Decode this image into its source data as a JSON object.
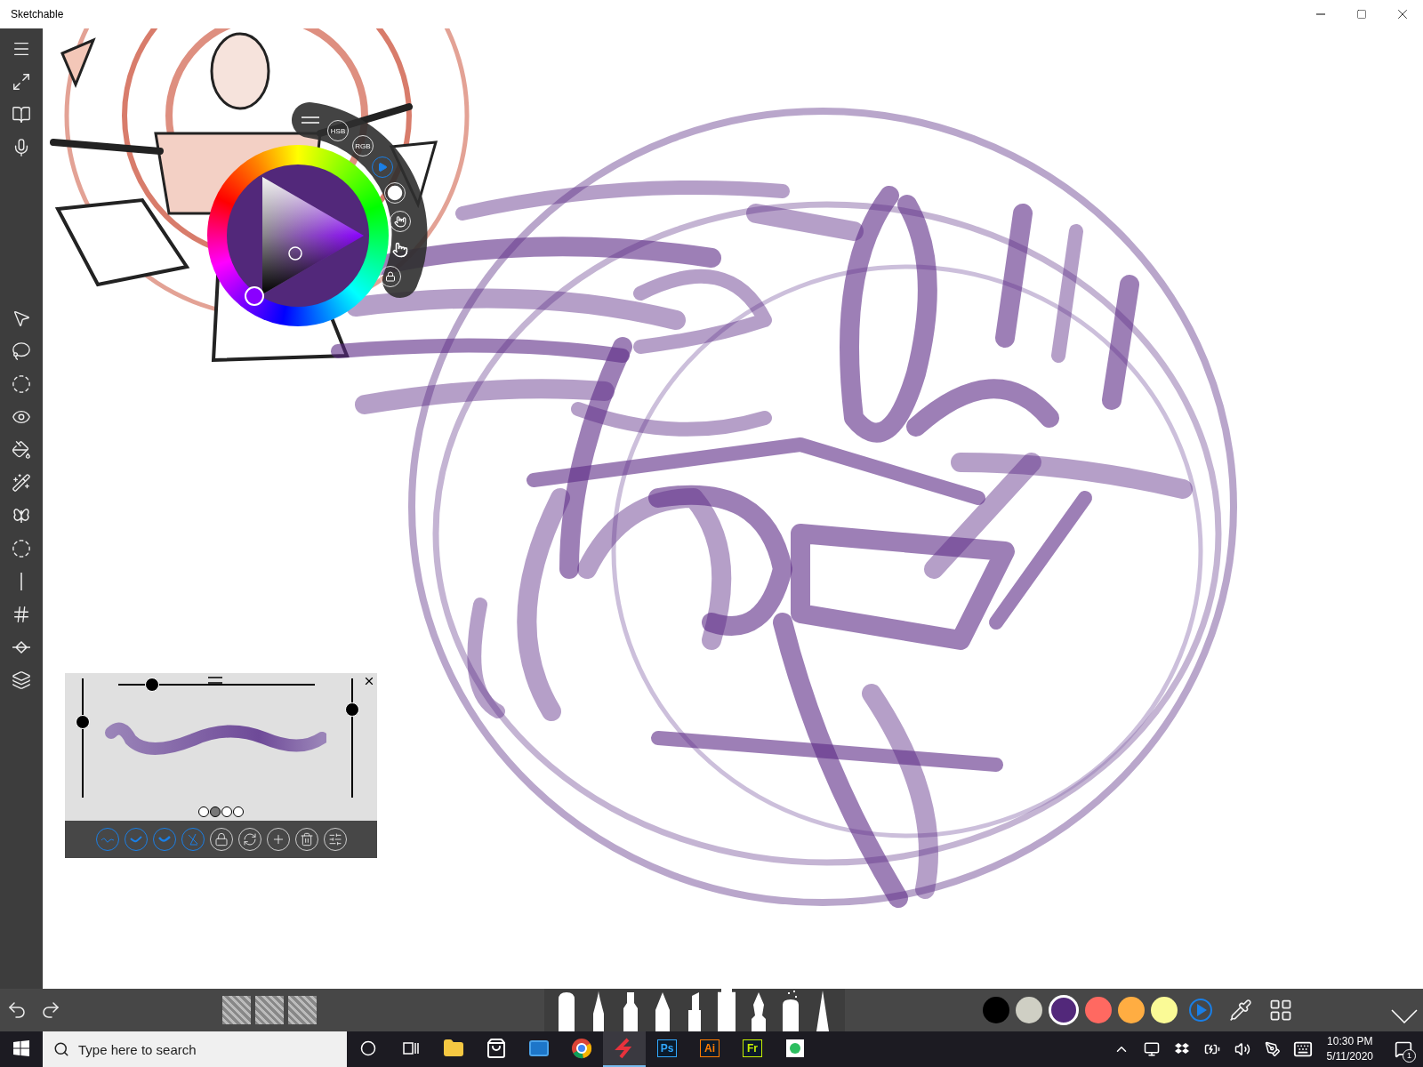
{
  "window": {
    "title": "Sketchable"
  },
  "color_wheel": {
    "modes": [
      {
        "label": "HSB",
        "selected": false
      },
      {
        "label": "RGB",
        "selected": false
      }
    ],
    "play_selected": true
  },
  "brush_panel": {
    "sliders": [
      {
        "kind": "horizontal",
        "level": 0.15
      },
      {
        "kind": "vertical-left",
        "level": 0.65
      },
      {
        "kind": "vertical-right",
        "level": 0.77
      }
    ],
    "pages": [
      {
        "selected": false
      },
      {
        "selected": true
      },
      {
        "selected": false
      },
      {
        "selected": false
      }
    ],
    "actions": [
      {
        "kind": "stroke",
        "active": true
      },
      {
        "kind": "taper-start",
        "active": true
      },
      {
        "kind": "taper-end",
        "active": true
      },
      {
        "kind": "no-pressure",
        "active": true
      },
      {
        "kind": "lock",
        "active": false
      },
      {
        "kind": "sync",
        "active": false
      },
      {
        "kind": "add",
        "active": false
      },
      {
        "kind": "delete",
        "active": false
      },
      {
        "kind": "settings",
        "active": false
      }
    ]
  },
  "brushes": [
    {
      "kind": "eraser",
      "selected": false
    },
    {
      "kind": "paintbrush",
      "selected": false
    },
    {
      "kind": "tube",
      "selected": false
    },
    {
      "kind": "pencil",
      "selected": false
    },
    {
      "kind": "lipstick",
      "selected": false
    },
    {
      "kind": "marker",
      "selected": true
    },
    {
      "kind": "pen",
      "selected": false
    },
    {
      "kind": "spray",
      "selected": false
    },
    {
      "kind": "cone",
      "selected": false
    }
  ],
  "palette": [
    {
      "color": "#000000",
      "selected": false
    },
    {
      "color": "#cfcfc4",
      "selected": false
    },
    {
      "color": "#52287a",
      "selected": true
    },
    {
      "color": "#ff6961",
      "selected": false
    },
    {
      "color": "#ffad42",
      "selected": false
    },
    {
      "color": "#fafa96",
      "selected": false
    }
  ],
  "taskbar": {
    "search": {
      "placeholder": "Type here to search"
    },
    "apps": [
      {
        "kind": "explorer",
        "active": false
      },
      {
        "kind": "store",
        "active": false
      },
      {
        "kind": "mail",
        "active": false
      },
      {
        "kind": "browser",
        "active": false
      },
      {
        "kind": "sketch",
        "active": true
      },
      {
        "kind": "badge",
        "label": "Ps",
        "color": "#31a8ff",
        "active": false
      },
      {
        "kind": "badge",
        "label": "Ai",
        "color": "#ff7c00",
        "active": false
      },
      {
        "kind": "badge",
        "label": "Fr",
        "color": "#c5f000",
        "active": false
      },
      {
        "kind": "note",
        "active": false
      }
    ],
    "time": "10:30 PM",
    "date": "5/11/2020",
    "notifications": "1"
  }
}
